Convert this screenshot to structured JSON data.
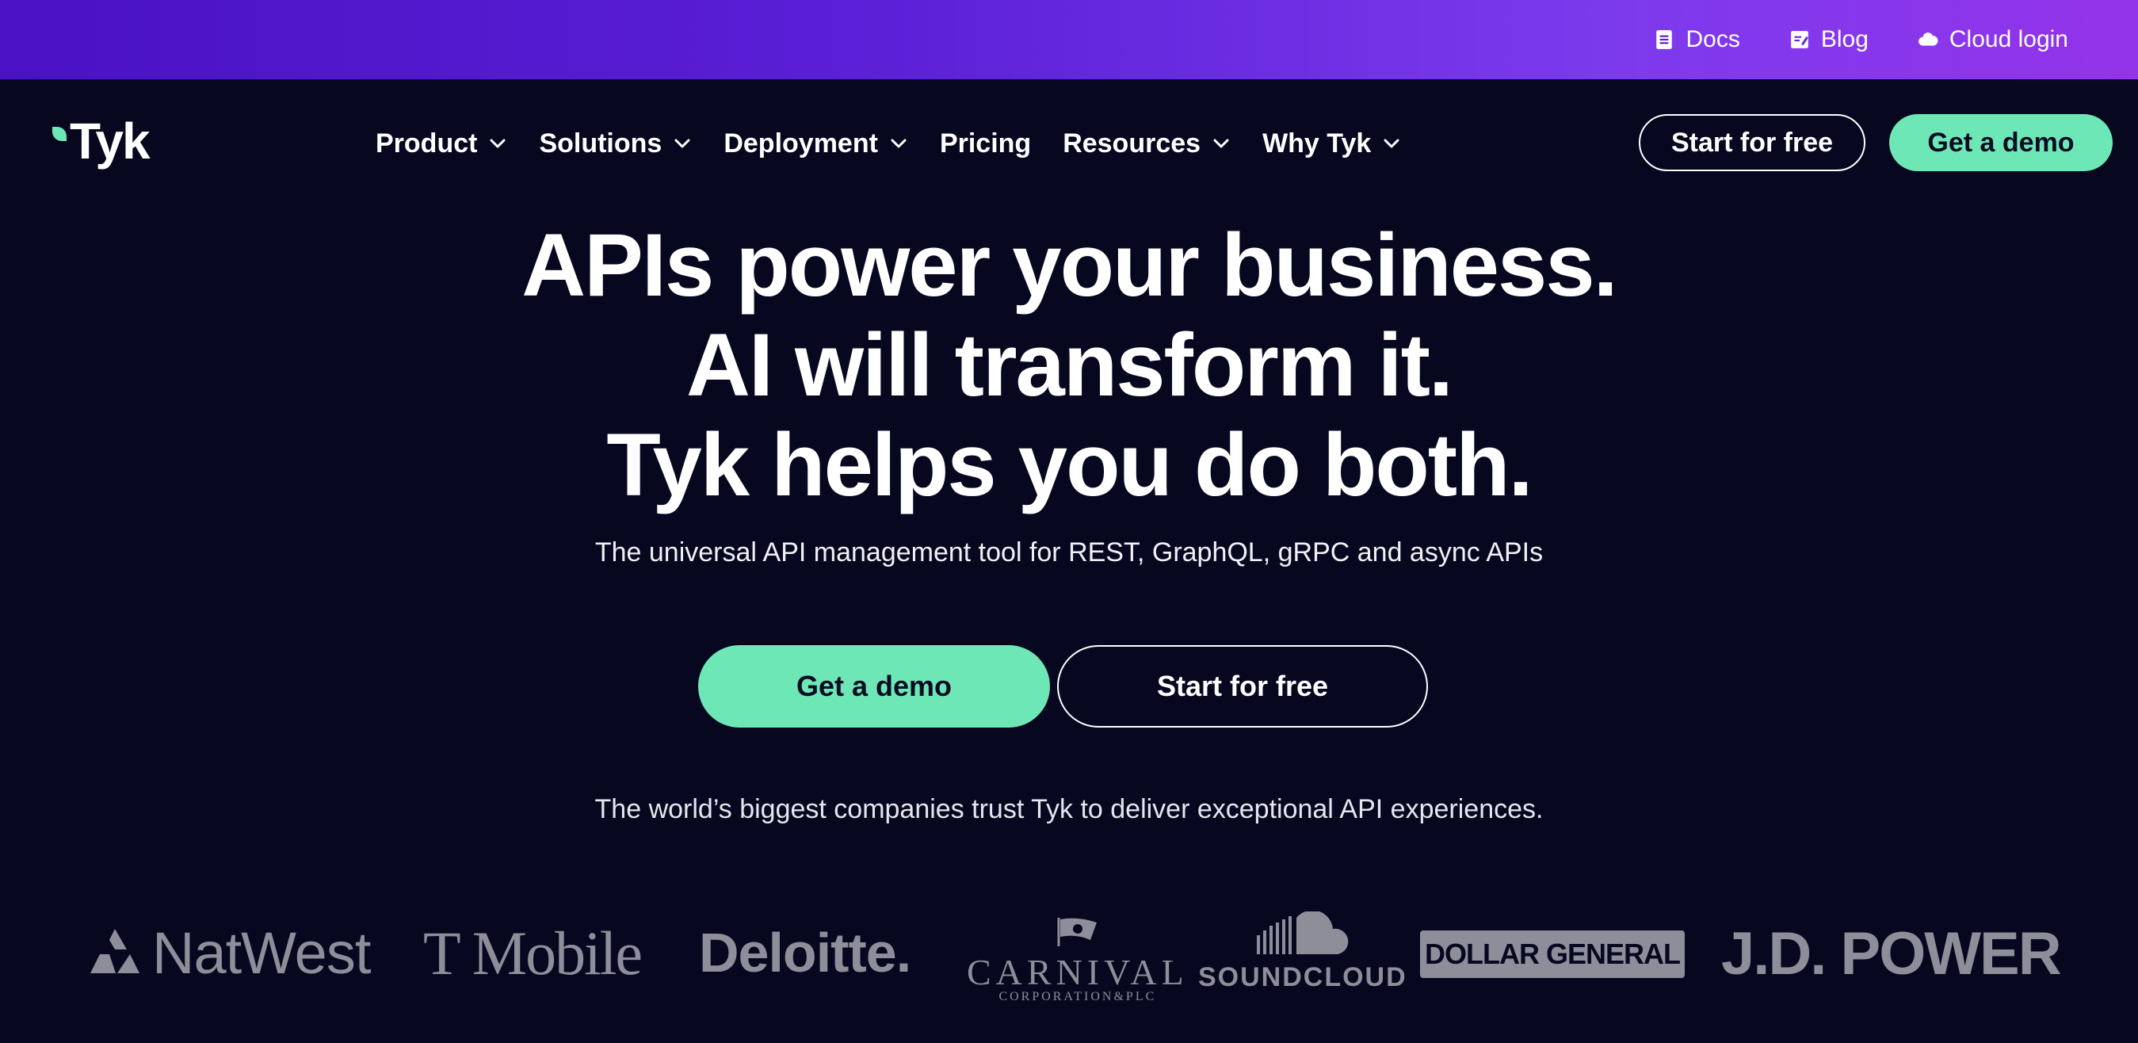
{
  "topbar": {
    "links": [
      {
        "label": "Docs",
        "icon": "document-icon"
      },
      {
        "label": "Blog",
        "icon": "edit-note-icon"
      },
      {
        "label": "Cloud login",
        "icon": "cloud-icon"
      }
    ]
  },
  "brand": {
    "name": "Tyk",
    "accent": "#6ee7b7"
  },
  "nav": {
    "items": [
      {
        "label": "Product",
        "dropdown": true
      },
      {
        "label": "Solutions",
        "dropdown": true
      },
      {
        "label": "Deployment",
        "dropdown": true
      },
      {
        "label": "Pricing",
        "dropdown": false
      },
      {
        "label": "Resources",
        "dropdown": true
      },
      {
        "label": "Why Tyk",
        "dropdown": true
      }
    ],
    "start_free_label": "Start for free",
    "get_demo_label": "Get a demo"
  },
  "hero": {
    "lines": [
      "APIs power your business.",
      "AI will transform it.",
      "Tyk helps you do both."
    ],
    "subtitle": "The universal API management tool for REST, GraphQL, gRPC and async APIs",
    "primary_cta": "Get a demo",
    "secondary_cta": "Start for free",
    "trust_text": "The world’s biggest companies trust Tyk to deliver exceptional API experiences."
  },
  "logos": {
    "natwest": "NatWest",
    "tmobile": "T Mobile",
    "deloitte": "Deloitte.",
    "carnival": "CARNIVAL",
    "carnival_sub": "CORPORATION&PLC",
    "soundcloud": "SOUNDCLOUD",
    "dollar_general": "DOLLAR GENERAL",
    "jdpower": "J.D. POWER"
  },
  "colors": {
    "background": "#070720",
    "topbar_start": "#4a12c4",
    "topbar_end": "#9333ea",
    "cta_green": "#6ee7b7",
    "logo_gray": "#8e8e9a"
  }
}
